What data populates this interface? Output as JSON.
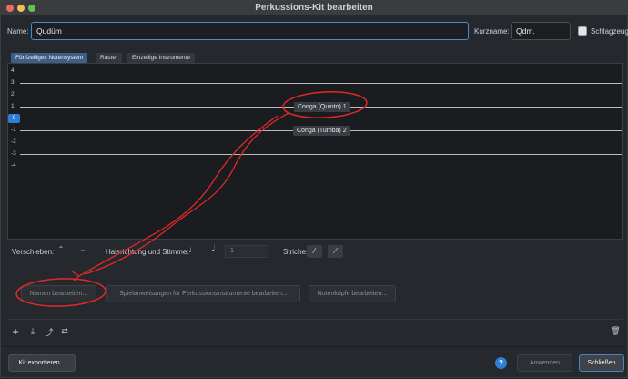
{
  "window": {
    "title": "Perkussions-Kit bearbeiten"
  },
  "form": {
    "name_label": "Name:",
    "name_value": "Qudüm",
    "short_label": "Kurzname:",
    "short_value": "Qdm.",
    "drumset_label": "Schlagzeug"
  },
  "tabs": [
    {
      "label": "Fünfzeiliges Notensystem",
      "active": true
    },
    {
      "label": "Raster",
      "active": false
    },
    {
      "label": "Einzeilige Instrumente",
      "active": false
    }
  ],
  "staff": {
    "positions": [
      "4",
      "3",
      "2",
      "1",
      "0",
      "-1",
      "-2",
      "-3",
      "-4"
    ],
    "selected_position": "0",
    "instruments": [
      {
        "label": "Conga (Quinto) 1",
        "position": "1"
      },
      {
        "label": "Conga (Tumba) 2",
        "position": "-1"
      }
    ]
  },
  "controls": {
    "move_label": "Verschieben:",
    "move_up_icon": "chevron-up-icon",
    "move_down_icon": "chevron-down-icon",
    "stem_label": "Halsrichtung und Stimme:",
    "voice_value": "1",
    "strokes_label": "Striche:"
  },
  "actions": {
    "edit_names": "Namen bearbeiten...",
    "edit_techniques": "Spielanweisungen für Perkussionsinstrumente bearbeiten...",
    "edit_noteheads": "Notenköpfe bearbeiten..."
  },
  "footer": {
    "export_label": "Kit exportieren...",
    "help_label": "?",
    "apply_label": "Anwenden",
    "close_label": "Schließen"
  },
  "colors": {
    "accent": "#2f7ed6",
    "annotation": "#e0282a"
  }
}
